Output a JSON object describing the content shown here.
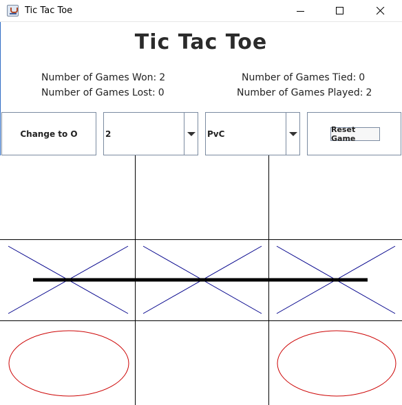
{
  "window": {
    "title": "Tic Tac Toe",
    "icon": "java-cup-icon",
    "controls": [
      "minimize-icon",
      "maximize-icon",
      "close-icon"
    ]
  },
  "heading": "Tic Tac Toe",
  "stats": {
    "won_label": "Number of Games Won:",
    "won_value": "2",
    "lost_label": "Number of Games Lost:",
    "lost_value": "0",
    "tied_label": "Number of Games Tied:",
    "tied_value": "0",
    "played_label": "Number of Games Played:",
    "played_value": "2"
  },
  "controls": {
    "change_label": "Change to O",
    "difficulty_value": "2",
    "mode_value": "PvC",
    "reset_label": "Reset Game"
  },
  "board": {
    "cells": [
      [
        "",
        "",
        ""
      ],
      [
        "X",
        "X",
        "X"
      ],
      [
        "O",
        "",
        "O"
      ]
    ],
    "win_line": "row-2",
    "colors": {
      "x": "#00008b",
      "o": "#cc0000",
      "grid": "#000000",
      "win_line": "#000000"
    }
  }
}
